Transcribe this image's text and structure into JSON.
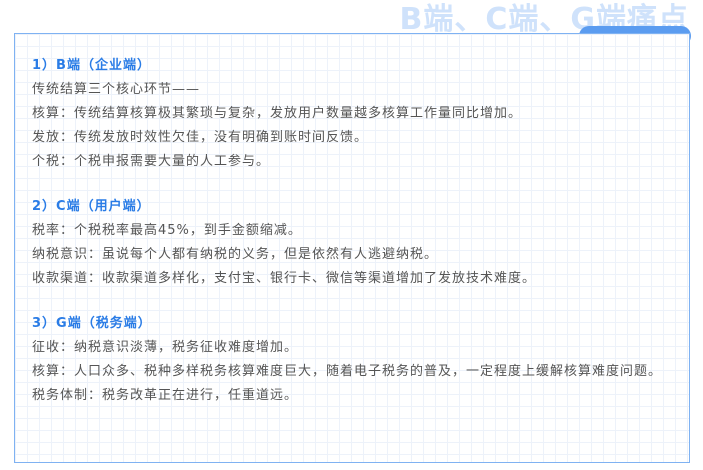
{
  "banner": {
    "title": "B端、C端、G端痛点"
  },
  "sections": [
    {
      "title": "1）B端（企业端）",
      "lines": [
        "传统结算三个核心环节——",
        "核算：传统结算核算极其繁琐与复杂，发放用户数量越多核算工作量同比增加。",
        "发放：传统发放时效性欠佳，没有明确到账时间反馈。",
        "个税：个税申报需要大量的人工参与。"
      ]
    },
    {
      "title": "2）C端（用户端）",
      "lines": [
        "税率：个税税率最高45%，到手金额缩减。",
        "纳税意识：虽说每个人都有纳税的义务，但是依然有人逃避纳税。",
        "收款渠道：收款渠道多样化，支付宝、银行卡、微信等渠道增加了发放技术难度。"
      ]
    },
    {
      "title": "3）G端（税务端）",
      "lines": [
        "征收：纳税意识淡薄，税务征收难度增加。",
        "核算：人口众多、税种多样税务核算难度巨大，随着电子税务的普及，一定程度上缓解核算难度问题。",
        "税务体制：税务改革正在进行，任重道远。"
      ]
    }
  ]
}
